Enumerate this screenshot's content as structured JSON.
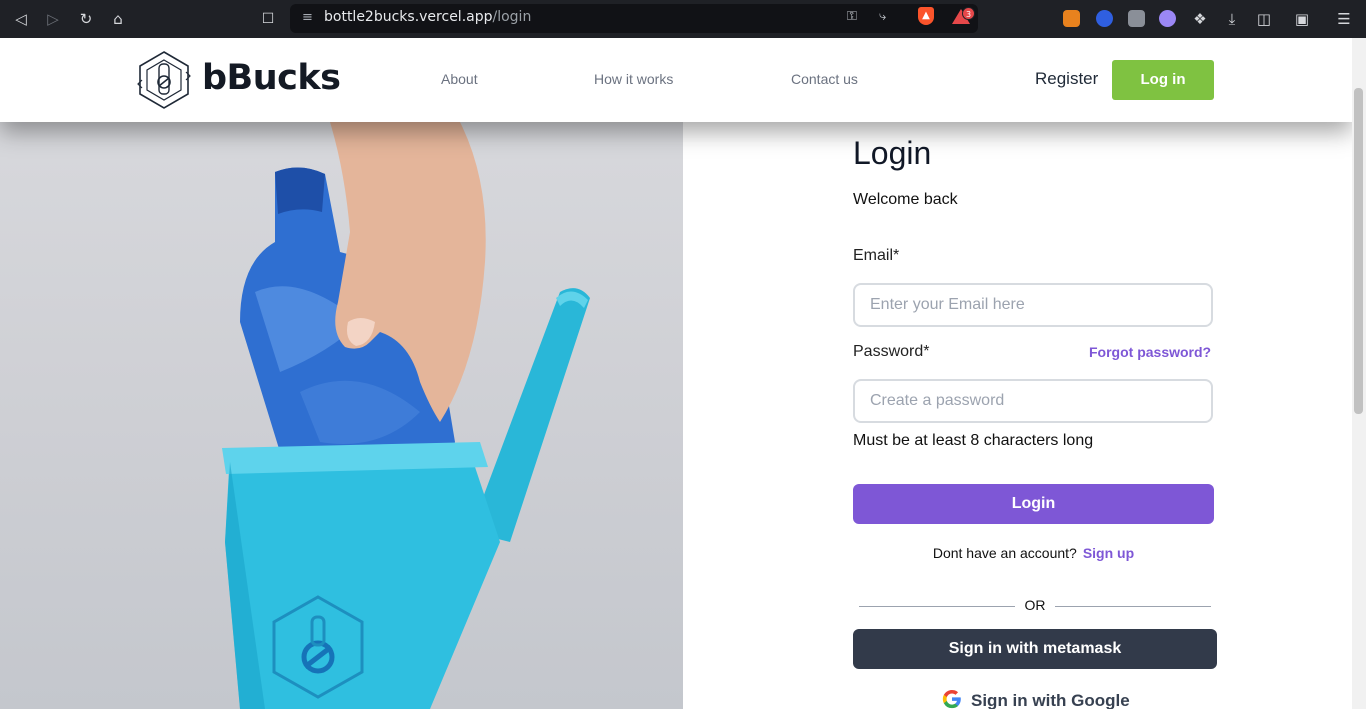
{
  "browser": {
    "url_host": "bottle2bucks.vercel.app",
    "url_path": "/login",
    "notification_count": "3"
  },
  "nav": {
    "brand": "bBucks",
    "links": [
      "About",
      "How it works",
      "Contact us"
    ],
    "register": "Register",
    "login": "Log in"
  },
  "form": {
    "title": "Login",
    "subtitle": "Welcome back",
    "email_label": "Email*",
    "email_placeholder": "Enter your Email here",
    "password_label": "Password*",
    "forgot": "Forgot password?",
    "password_placeholder": "Create a password",
    "hint": "Must be at least 8 characters long",
    "submit": "Login",
    "no_account": "Dont have an account?",
    "signup": "Sign up",
    "or": "OR",
    "metamask": "Sign in with metamask",
    "google": "Sign in with Google"
  },
  "colors": {
    "accent_purple": "#7e57d6",
    "brand_green": "#7fc241",
    "dark_button": "#323a4a"
  }
}
